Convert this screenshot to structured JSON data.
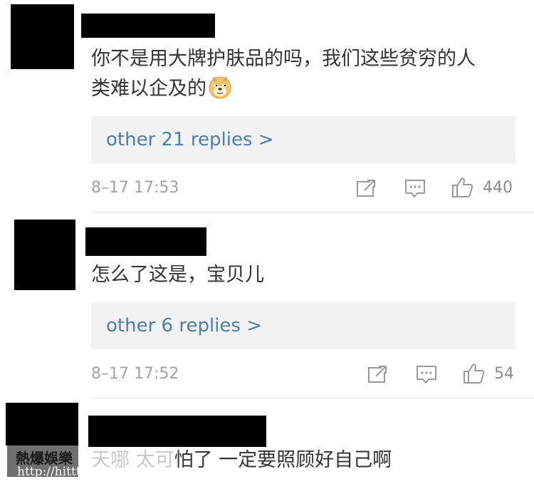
{
  "comments": [
    {
      "text_line1": "你不是用大牌护肤品的吗，我们这些贫穷的人",
      "text_line2": "类难以企及的",
      "emoji": "doge-emoji",
      "replies_link": "other 21 replies >",
      "timestamp": "8–17 17:53",
      "likes": "440"
    },
    {
      "text_line1": "怎么了这是，宝贝儿",
      "replies_link": "other 6 replies >",
      "timestamp": "8–17 17:52",
      "likes": "54"
    },
    {
      "text_faded": "天哪 太可",
      "text_rest": "怕了 一定要照顾好自己啊"
    }
  ],
  "icons": {
    "share": "share-icon",
    "comment": "comment-icon",
    "like": "thumbs-up-icon"
  },
  "watermark": {
    "title": "熱爆娛樂",
    "url": "http://hittt.blogspot.com"
  },
  "colors": {
    "link": "#4a7fb3",
    "reply_background": "#f2f2f2",
    "meta": "#a2a2a2",
    "redaction": "#000000"
  }
}
